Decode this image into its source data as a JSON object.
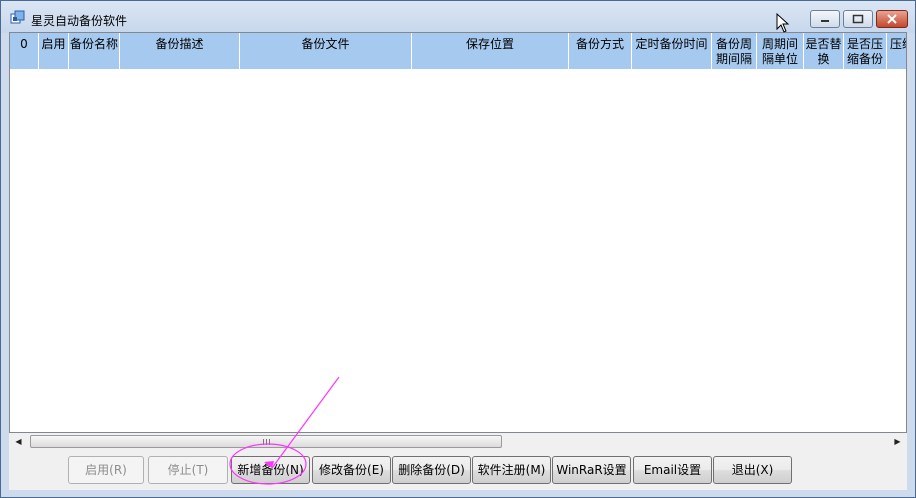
{
  "window": {
    "title": "星灵自动备份软件",
    "app_icon": "windows-app-icon"
  },
  "grid": {
    "columns": [
      "0",
      "启用",
      "备份名称",
      "备份描述",
      "备份文件",
      "保存位置",
      "备份方式",
      "定时备份时间",
      "备份周\n期间隔",
      "周期间\n隔单位",
      "是否替\n换",
      "是否压\n缩备份",
      "压缩"
    ],
    "rows": []
  },
  "buttons": {
    "enable": "启用(R)",
    "stop": "停止(T)",
    "new_backup": "新增备份(N)",
    "edit_backup": "修改备份(E)",
    "delete_backup": "删除备份(D)",
    "register": "软件注册(M)",
    "winrar": "WinRaR设置",
    "email": "Email设置",
    "exit": "退出(X)"
  },
  "colors": {
    "header_bg": "#a6c9f0",
    "annotation": "#ff33ff"
  }
}
